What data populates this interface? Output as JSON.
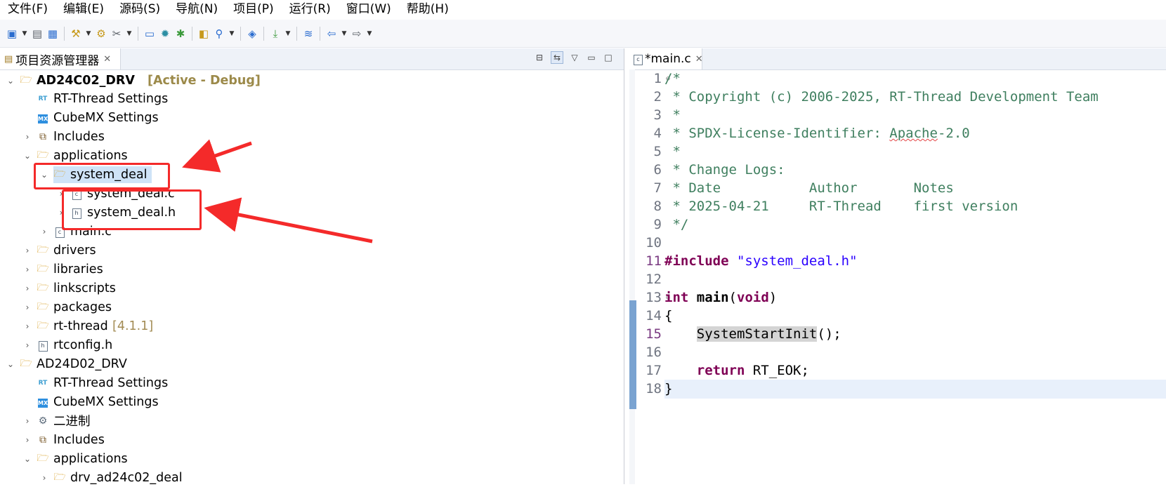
{
  "menu": [
    "文件(F)",
    "编辑(E)",
    "源码(S)",
    "导航(N)",
    "项目(P)",
    "运行(R)",
    "窗口(W)",
    "帮助(H)"
  ],
  "left_panel": {
    "tab_title": "项目资源管理器",
    "tree": [
      {
        "label": "AD24C02_DRV",
        "suffix": "[Active - Debug]"
      },
      {
        "label": "RT-Thread Settings"
      },
      {
        "label": "CubeMX Settings"
      },
      {
        "label": "Includes"
      },
      {
        "label": "applications"
      },
      {
        "label": "system_deal"
      },
      {
        "label": "system_deal.c"
      },
      {
        "label": "system_deal.h"
      },
      {
        "label": "main.c"
      },
      {
        "label": "drivers"
      },
      {
        "label": "libraries"
      },
      {
        "label": "linkscripts"
      },
      {
        "label": "packages"
      },
      {
        "label": "rt-thread",
        "suffix": "[4.1.1]"
      },
      {
        "label": "rtconfig.h"
      },
      {
        "label": "AD24D02_DRV"
      },
      {
        "label": "RT-Thread Settings"
      },
      {
        "label": "CubeMX Settings"
      },
      {
        "label": "二进制"
      },
      {
        "label": "Includes"
      },
      {
        "label": "applications"
      },
      {
        "label": "drv_ad24c02_deal"
      }
    ]
  },
  "editor": {
    "tab_title": "*main.c",
    "line_numbers": [
      "1",
      "2",
      "3",
      "4",
      "5",
      "6",
      "7",
      "8",
      "9",
      "10",
      "11",
      "12",
      "13",
      "14",
      "15",
      "16",
      "17",
      "18"
    ],
    "code": {
      "l1": "/*",
      "l2": " * Copyright (c) 2006-2025, RT-Thread Development Team",
      "l3": " *",
      "l4_a": " * SPDX-License-Identifier: ",
      "l4_b": "Apache",
      "l4_c": "-2.0",
      "l5": " *",
      "l6": " * Change Logs:",
      "l7": " * Date           Author       Notes",
      "l8": " * 2025-04-21     RT-Thread    first version",
      "l9": " */",
      "l11_kw": "#include",
      "l11_str": "\"system_deal.h\"",
      "l13_kw1": "int",
      "l13_fn": "main",
      "l13_p1": "(",
      "l13_kw2": "void",
      "l13_p2": ")",
      "l14": "{",
      "l15_fn": "SystemStartInit",
      "l15_rest": "();",
      "l17_kw": "return",
      "l17_rest": " RT_EOK;",
      "l18": "}"
    }
  },
  "colors": {
    "annotation": "#f42a2a",
    "comment": "#3f7f5f",
    "keyword": "#7f0055",
    "string": "#2a00ff"
  }
}
